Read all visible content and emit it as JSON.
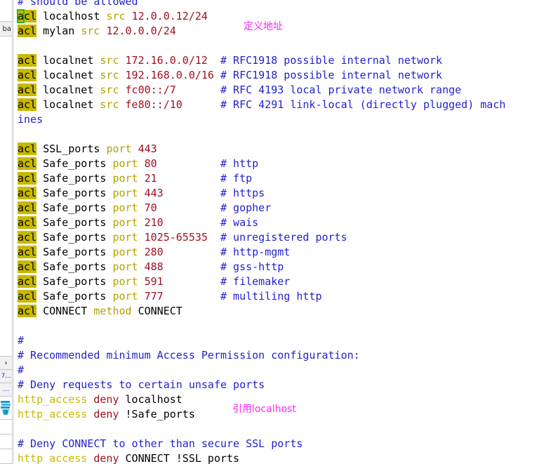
{
  "window": {
    "type": "text-editor",
    "filename_tab_stub": "ba"
  },
  "left_rail": {
    "items": [
      {
        "name": "expand-chevron",
        "label": "›",
        "kind": "chevron"
      },
      {
        "name": "rail-entry-7",
        "label": "7…",
        "kind": "number"
      },
      {
        "name": "rail-entry-1",
        "label": "…",
        "kind": "number"
      },
      {
        "name": "rail-icon-dock",
        "label": "",
        "kind": "icon"
      },
      {
        "name": "rail-slot-a",
        "label": "",
        "kind": "blank"
      },
      {
        "name": "rail-slot-b",
        "label": "",
        "kind": "blank"
      },
      {
        "name": "rail-slot-c",
        "label": "",
        "kind": "blank"
      }
    ]
  },
  "annotations": [
    {
      "name": "annotation-define-address",
      "text": "定义地址",
      "color": "#ff22ff"
    },
    {
      "name": "annotation-refer-localhost",
      "text": "引用localhost",
      "color": "#ff22ff"
    }
  ],
  "colors": {
    "keyword_bg": "#c8b900",
    "attribute": "#b3a300",
    "value": "#a01020",
    "comment": "#2222cc",
    "directive": "#c8b900",
    "cursor_outline": "#19c219",
    "background": "#ffffff"
  },
  "code": {
    "language": "squid.conf",
    "lines": [
      {
        "id": "l00",
        "segments": [
          {
            "t": "# should be allowed",
            "c": "cmt"
          }
        ]
      },
      {
        "id": "l01",
        "segments": [
          {
            "t": "a",
            "c": "cursor"
          },
          {
            "t": "cl",
            "c": "acl"
          },
          {
            "t": " localhost ",
            "c": "plain"
          },
          {
            "t": "src",
            "c": "attr"
          },
          {
            "t": " ",
            "c": "plain"
          },
          {
            "t": "12.0.0.12/24",
            "c": "val"
          }
        ]
      },
      {
        "id": "l02",
        "segments": [
          {
            "t": "acl",
            "c": "acl"
          },
          {
            "t": " mylan ",
            "c": "plain"
          },
          {
            "t": "src",
            "c": "attr"
          },
          {
            "t": " ",
            "c": "plain"
          },
          {
            "t": "12.0.0.0/24",
            "c": "val"
          }
        ]
      },
      {
        "id": "l03",
        "segments": []
      },
      {
        "id": "l04",
        "segments": [
          {
            "t": "acl",
            "c": "acl"
          },
          {
            "t": " localnet ",
            "c": "plain"
          },
          {
            "t": "src",
            "c": "attr"
          },
          {
            "t": " ",
            "c": "plain"
          },
          {
            "t": "172.16.0.0/12",
            "c": "val"
          },
          {
            "t": "  ",
            "c": "plain"
          },
          {
            "t": "# RFC1918 possible internal network",
            "c": "cmt"
          }
        ]
      },
      {
        "id": "l05",
        "segments": [
          {
            "t": "acl",
            "c": "acl"
          },
          {
            "t": " localnet ",
            "c": "plain"
          },
          {
            "t": "src",
            "c": "attr"
          },
          {
            "t": " ",
            "c": "plain"
          },
          {
            "t": "192.168.0.0/16",
            "c": "val"
          },
          {
            "t": " ",
            "c": "plain"
          },
          {
            "t": "# RFC1918 possible internal network",
            "c": "cmt"
          }
        ]
      },
      {
        "id": "l06",
        "segments": [
          {
            "t": "acl",
            "c": "acl"
          },
          {
            "t": " localnet ",
            "c": "plain"
          },
          {
            "t": "src",
            "c": "attr"
          },
          {
            "t": " ",
            "c": "plain"
          },
          {
            "t": "fc00::/7",
            "c": "val"
          },
          {
            "t": "       ",
            "c": "plain"
          },
          {
            "t": "# RFC 4193 local private network range",
            "c": "cmt"
          }
        ]
      },
      {
        "id": "l07",
        "segments": [
          {
            "t": "acl",
            "c": "acl"
          },
          {
            "t": " localnet ",
            "c": "plain"
          },
          {
            "t": "src",
            "c": "attr"
          },
          {
            "t": " ",
            "c": "plain"
          },
          {
            "t": "fe80::/10",
            "c": "val"
          },
          {
            "t": "      ",
            "c": "plain"
          },
          {
            "t": "# RFC 4291 link-local (directly plugged) mach",
            "c": "cmt"
          }
        ]
      },
      {
        "id": "l08",
        "segments": [
          {
            "t": "ines",
            "c": "cmt"
          }
        ]
      },
      {
        "id": "l09",
        "segments": []
      },
      {
        "id": "l10",
        "segments": [
          {
            "t": "acl",
            "c": "acl"
          },
          {
            "t": " SSL_ports ",
            "c": "plain"
          },
          {
            "t": "port",
            "c": "attr"
          },
          {
            "t": " ",
            "c": "plain"
          },
          {
            "t": "443",
            "c": "val"
          }
        ]
      },
      {
        "id": "l11",
        "segments": [
          {
            "t": "acl",
            "c": "acl"
          },
          {
            "t": " Safe_ports ",
            "c": "plain"
          },
          {
            "t": "port",
            "c": "attr"
          },
          {
            "t": " ",
            "c": "plain"
          },
          {
            "t": "80",
            "c": "val"
          },
          {
            "t": "          ",
            "c": "plain"
          },
          {
            "t": "# http",
            "c": "cmt"
          }
        ]
      },
      {
        "id": "l12",
        "segments": [
          {
            "t": "acl",
            "c": "acl"
          },
          {
            "t": " Safe_ports ",
            "c": "plain"
          },
          {
            "t": "port",
            "c": "attr"
          },
          {
            "t": " ",
            "c": "plain"
          },
          {
            "t": "21",
            "c": "val"
          },
          {
            "t": "          ",
            "c": "plain"
          },
          {
            "t": "# ftp",
            "c": "cmt"
          }
        ]
      },
      {
        "id": "l13",
        "segments": [
          {
            "t": "acl",
            "c": "acl"
          },
          {
            "t": " Safe_ports ",
            "c": "plain"
          },
          {
            "t": "port",
            "c": "attr"
          },
          {
            "t": " ",
            "c": "plain"
          },
          {
            "t": "443",
            "c": "val"
          },
          {
            "t": "         ",
            "c": "plain"
          },
          {
            "t": "# https",
            "c": "cmt"
          }
        ]
      },
      {
        "id": "l14",
        "segments": [
          {
            "t": "acl",
            "c": "acl"
          },
          {
            "t": " Safe_ports ",
            "c": "plain"
          },
          {
            "t": "port",
            "c": "attr"
          },
          {
            "t": " ",
            "c": "plain"
          },
          {
            "t": "70",
            "c": "val"
          },
          {
            "t": "          ",
            "c": "plain"
          },
          {
            "t": "# gopher",
            "c": "cmt"
          }
        ]
      },
      {
        "id": "l15",
        "segments": [
          {
            "t": "acl",
            "c": "acl"
          },
          {
            "t": " Safe_ports ",
            "c": "plain"
          },
          {
            "t": "port",
            "c": "attr"
          },
          {
            "t": " ",
            "c": "plain"
          },
          {
            "t": "210",
            "c": "val"
          },
          {
            "t": "         ",
            "c": "plain"
          },
          {
            "t": "# wais",
            "c": "cmt"
          }
        ]
      },
      {
        "id": "l16",
        "segments": [
          {
            "t": "acl",
            "c": "acl"
          },
          {
            "t": " Safe_ports ",
            "c": "plain"
          },
          {
            "t": "port",
            "c": "attr"
          },
          {
            "t": " ",
            "c": "plain"
          },
          {
            "t": "1025-65535",
            "c": "val"
          },
          {
            "t": "  ",
            "c": "plain"
          },
          {
            "t": "# unregistered ports",
            "c": "cmt"
          }
        ]
      },
      {
        "id": "l17",
        "segments": [
          {
            "t": "acl",
            "c": "acl"
          },
          {
            "t": " Safe_ports ",
            "c": "plain"
          },
          {
            "t": "port",
            "c": "attr"
          },
          {
            "t": " ",
            "c": "plain"
          },
          {
            "t": "280",
            "c": "val"
          },
          {
            "t": "         ",
            "c": "plain"
          },
          {
            "t": "# http-mgmt",
            "c": "cmt"
          }
        ]
      },
      {
        "id": "l18",
        "segments": [
          {
            "t": "acl",
            "c": "acl"
          },
          {
            "t": " Safe_ports ",
            "c": "plain"
          },
          {
            "t": "port",
            "c": "attr"
          },
          {
            "t": " ",
            "c": "plain"
          },
          {
            "t": "488",
            "c": "val"
          },
          {
            "t": "         ",
            "c": "plain"
          },
          {
            "t": "# gss-http",
            "c": "cmt"
          }
        ]
      },
      {
        "id": "l19",
        "segments": [
          {
            "t": "acl",
            "c": "acl"
          },
          {
            "t": " Safe_ports ",
            "c": "plain"
          },
          {
            "t": "port",
            "c": "attr"
          },
          {
            "t": " ",
            "c": "plain"
          },
          {
            "t": "591",
            "c": "val"
          },
          {
            "t": "         ",
            "c": "plain"
          },
          {
            "t": "# filemaker",
            "c": "cmt"
          }
        ]
      },
      {
        "id": "l20",
        "segments": [
          {
            "t": "acl",
            "c": "acl"
          },
          {
            "t": " Safe_ports ",
            "c": "plain"
          },
          {
            "t": "port",
            "c": "attr"
          },
          {
            "t": " ",
            "c": "plain"
          },
          {
            "t": "777",
            "c": "val"
          },
          {
            "t": "         ",
            "c": "plain"
          },
          {
            "t": "# multiling http",
            "c": "cmt"
          }
        ]
      },
      {
        "id": "l21",
        "segments": [
          {
            "t": "acl",
            "c": "acl"
          },
          {
            "t": " CONNECT ",
            "c": "plain"
          },
          {
            "t": "method",
            "c": "attr"
          },
          {
            "t": " CONNECT",
            "c": "plain"
          }
        ]
      },
      {
        "id": "l22",
        "segments": []
      },
      {
        "id": "l23",
        "segments": [
          {
            "t": "#",
            "c": "cmt"
          }
        ]
      },
      {
        "id": "l24",
        "segments": [
          {
            "t": "# Recommended minimum Access Permission configuration:",
            "c": "cmt"
          }
        ]
      },
      {
        "id": "l25",
        "segments": [
          {
            "t": "#",
            "c": "cmt"
          }
        ]
      },
      {
        "id": "l26",
        "segments": [
          {
            "t": "# Deny requests to certain unsafe ports",
            "c": "cmt"
          }
        ]
      },
      {
        "id": "l27",
        "segments": [
          {
            "t": "http_access",
            "c": "dir"
          },
          {
            "t": " ",
            "c": "plain"
          },
          {
            "t": "deny",
            "c": "deny"
          },
          {
            "t": " localhost",
            "c": "plain"
          }
        ]
      },
      {
        "id": "l28",
        "segments": [
          {
            "t": "http_access",
            "c": "dir"
          },
          {
            "t": " ",
            "c": "plain"
          },
          {
            "t": "deny",
            "c": "deny"
          },
          {
            "t": " !Safe_ports",
            "c": "plain"
          }
        ]
      },
      {
        "id": "l29",
        "segments": []
      },
      {
        "id": "l30",
        "segments": [
          {
            "t": "# Deny CONNECT to other than secure SSL ports",
            "c": "cmt"
          }
        ]
      },
      {
        "id": "l31",
        "segments": [
          {
            "t": "http_access",
            "c": "dir"
          },
          {
            "t": " ",
            "c": "plain"
          },
          {
            "t": "deny",
            "c": "deny"
          },
          {
            "t": " CONNECT !SSL_ports",
            "c": "plain"
          }
        ]
      }
    ]
  }
}
